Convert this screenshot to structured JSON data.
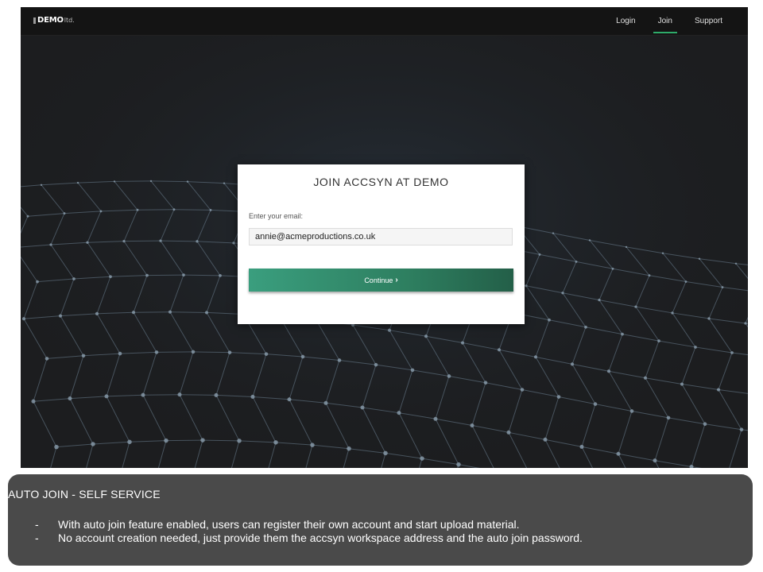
{
  "header": {
    "logo_name": "DEMO",
    "logo_suffix": "ltd.",
    "nav": [
      {
        "label": "Login",
        "active": false
      },
      {
        "label": "Join",
        "active": true
      },
      {
        "label": "Support",
        "active": false
      }
    ]
  },
  "join_card": {
    "title": "JOIN ACCSYN AT DEMO",
    "email_label": "Enter your email:",
    "email_value": "annie@acmeproductions.co.uk",
    "continue_label": "Continue",
    "continue_icon": "chevron-right-icon"
  },
  "caption": {
    "title": "AUTO JOIN - SELF SERVICE",
    "bullet": "-",
    "items": [
      "With auto join feature enabled, users can register their own account and start upload material.",
      "No account creation needed, just provide them the accsyn workspace address and the auto join password."
    ]
  },
  "colors": {
    "accent": "#2eab6a",
    "button": "#2e7f60",
    "background": "#1c1d1f",
    "caption_bg": "#4a4a4a"
  }
}
